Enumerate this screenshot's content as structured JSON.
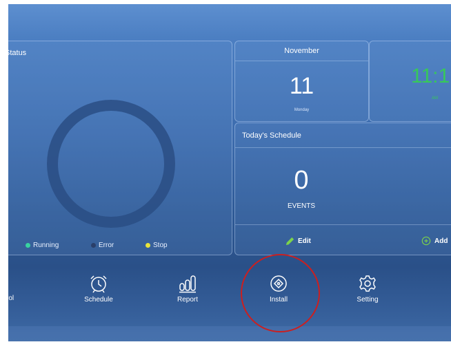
{
  "colors": {
    "running": "#39d3a0",
    "error": "#2a3f6a",
    "stop": "#e8e43a",
    "clock": "#37c85a",
    "highlight_circle": "#cc1f1f"
  },
  "status": {
    "title": "Status",
    "legend": [
      {
        "label": "Running",
        "color": "#39d3a0"
      },
      {
        "label": "Error",
        "color": "#2a3f6a"
      },
      {
        "label": "Stop",
        "color": "#e8e43a"
      }
    ]
  },
  "calendar": {
    "month": "November",
    "day": "11",
    "weekday": "Monday"
  },
  "clock": {
    "time": "11:1",
    "ampm": "AM"
  },
  "schedule": {
    "title": "Today's Schedule",
    "count": "0",
    "count_label": "EVENTS",
    "edit_label": "Edit",
    "add_label": "Add"
  },
  "nav": [
    {
      "label": "Control",
      "icon": "control-icon"
    },
    {
      "label": "Schedule",
      "icon": "alarm-clock-icon"
    },
    {
      "label": "Report",
      "icon": "bar-chart-icon"
    },
    {
      "label": "Install",
      "icon": "install-icon"
    },
    {
      "label": "Setting",
      "icon": "gear-icon"
    }
  ]
}
